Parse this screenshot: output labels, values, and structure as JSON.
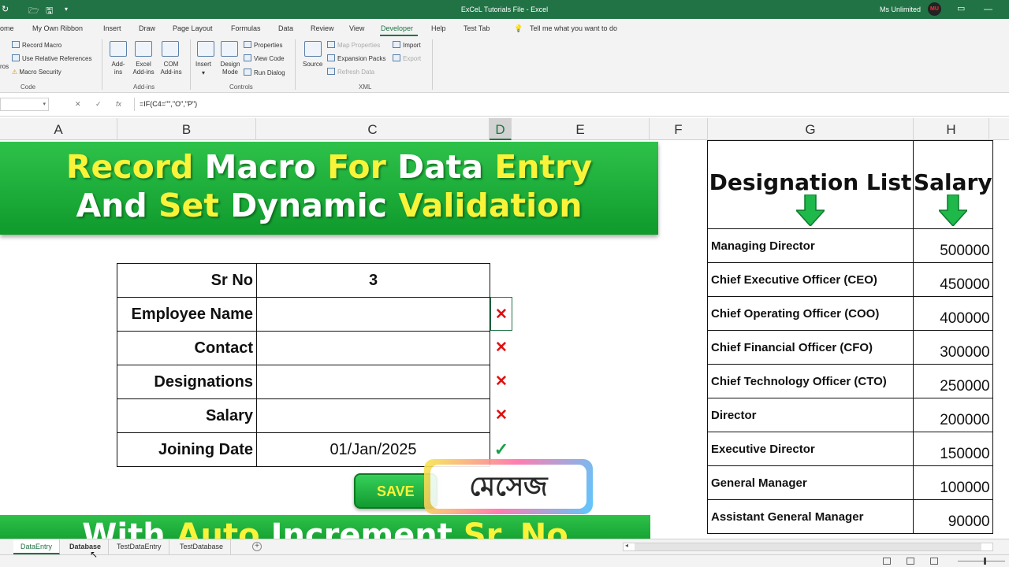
{
  "window": {
    "title": "ExCeL Tutorials File  -  Excel",
    "user": "Ms Unlimited",
    "avatar_text": "MU"
  },
  "menu": [
    "ome",
    "My Own Ribbon",
    "Insert",
    "Draw",
    "Page Layout",
    "Formulas",
    "Data",
    "Review",
    "View",
    "Developer",
    "Help",
    "Test Tab"
  ],
  "menu_active": "Developer",
  "tell_me": "Tell me what you want to do",
  "ribbon": {
    "code": {
      "macros_label": "ros",
      "record_macro": "Record Macro",
      "use_relative": "Use Relative References",
      "macro_security": "Macro Security",
      "group": "Code"
    },
    "addins": {
      "addins": "Add-ins",
      "excel_addins": "Excel Add-ins",
      "com_addins": "COM Add-ins",
      "group": "Add-ins"
    },
    "controls": {
      "insert": "Insert",
      "design_mode": "Design Mode",
      "properties": "Properties",
      "view_code": "View Code",
      "run_dialog": "Run Dialog",
      "group": "Controls"
    },
    "xml": {
      "source": "Source",
      "map_properties": "Map Properties",
      "expansion_packs": "Expansion Packs",
      "refresh_data": "Refresh Data",
      "import": "Import",
      "export": "Export",
      "group": "XML"
    }
  },
  "formula": {
    "namebox": "",
    "cancel": "✕",
    "enter": "✓",
    "fx": "fx",
    "text": "=IF(C4=\"\",\"O\",\"P\")"
  },
  "columns": [
    "A",
    "B",
    "C",
    "D",
    "E",
    "F",
    "G",
    "H"
  ],
  "selected_column": "D",
  "banner": {
    "line1": [
      {
        "t": "Record ",
        "c": "y"
      },
      {
        "t": "Macro ",
        "c": "w"
      },
      {
        "t": "For  ",
        "c": "y"
      },
      {
        "t": "Data ",
        "c": "w"
      },
      {
        "t": "Entry",
        "c": "y"
      }
    ],
    "line2": [
      {
        "t": "And  ",
        "c": "w"
      },
      {
        "t": "Set ",
        "c": "y"
      },
      {
        "t": "Dynamic ",
        "c": "w"
      },
      {
        "t": "Validation",
        "c": "y"
      }
    ]
  },
  "banner2": [
    {
      "t": "With ",
      "c": "w"
    },
    {
      "t": "Auto ",
      "c": "y"
    },
    {
      "t": "Increment ",
      "c": "w"
    },
    {
      "t": "Sr. ",
      "c": "y"
    },
    {
      "t": "No",
      "c": "y"
    }
  ],
  "form": {
    "rows": [
      {
        "label": "Sr No",
        "value": "3",
        "bold": true,
        "mark": "",
        "mark_type": ""
      },
      {
        "label": "Employee Name",
        "value": "",
        "bold": false,
        "mark": "✕",
        "mark_type": "x sel"
      },
      {
        "label": "Contact",
        "value": "",
        "bold": false,
        "mark": "✕",
        "mark_type": "x"
      },
      {
        "label": "Designations",
        "value": "",
        "bold": false,
        "mark": "✕",
        "mark_type": "x"
      },
      {
        "label": "Salary",
        "value": "",
        "bold": false,
        "mark": "✕",
        "mark_type": "x"
      },
      {
        "label": "Joining Date",
        "value": "01/Jan/2025",
        "bold": false,
        "mark": "✓",
        "mark_type": "ok"
      }
    ],
    "save_button": "SAVE"
  },
  "sticker": "মেসেজ",
  "designations": {
    "header_designation": "Designation List",
    "header_salary": "Salary",
    "rows": [
      {
        "name": "Managing Director",
        "salary": "500000"
      },
      {
        "name": "Chief Executive Officer (CEO)",
        "salary": "450000"
      },
      {
        "name": "Chief Operating Officer (COO)",
        "salary": "400000"
      },
      {
        "name": "Chief Financial Officer (CFO)",
        "salary": "300000"
      },
      {
        "name": "Chief Technology Officer (CTO)",
        "salary": "250000"
      },
      {
        "name": "Director",
        "salary": "200000"
      },
      {
        "name": "Executive Director",
        "salary": "150000"
      },
      {
        "name": "General Manager",
        "salary": "100000"
      },
      {
        "name": "Assistant General Manager",
        "salary": "90000"
      }
    ]
  },
  "tabs": [
    {
      "label": "DataEntry",
      "active": true,
      "bold": false
    },
    {
      "label": "Database",
      "active": false,
      "bold": true
    },
    {
      "label": "TestDataEntry",
      "active": false,
      "bold": false
    },
    {
      "label": "TestDatabase",
      "active": false,
      "bold": false
    }
  ],
  "colors": {
    "excel_green": "#217346",
    "banner_green": "#19b038",
    "banner_yellow": "#f9f339",
    "mark_red": "#dd1111",
    "mark_green": "#1aa04a"
  },
  "icons": [
    "undo-icon",
    "redo-icon",
    "open-icon",
    "save-icon",
    "customize-icon",
    "lightbulb-icon",
    "restore-icon",
    "minimize-icon",
    "close-icon"
  ]
}
